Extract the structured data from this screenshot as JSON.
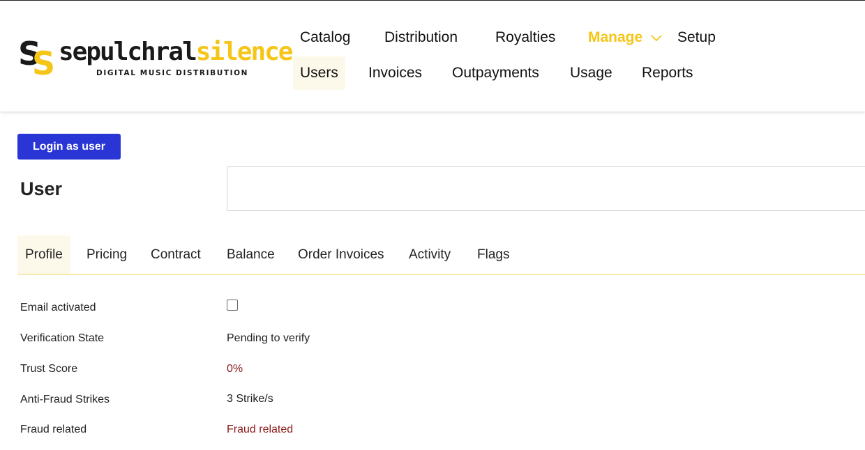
{
  "brand": {
    "name_part1": "sepulchral",
    "name_part2": "silence",
    "tagline": "DIGITAL MUSIC DISTRIBUTION",
    "colors": {
      "dark": "#1a1a1a",
      "accent": "#f5c518"
    }
  },
  "nav": {
    "top": [
      {
        "label": "Catalog"
      },
      {
        "label": "Distribution"
      },
      {
        "label": "Royalties"
      },
      {
        "label": "Manage",
        "active": true,
        "icon": "chevron-down-icon"
      },
      {
        "label": "Setup"
      }
    ],
    "sub": [
      {
        "label": "Users",
        "current": true
      },
      {
        "label": "Invoices"
      },
      {
        "label": "Outpayments"
      },
      {
        "label": "Usage"
      },
      {
        "label": "Reports"
      }
    ]
  },
  "actions": {
    "login_as_user": "Login as user",
    "button_color": "#2a35d6"
  },
  "page": {
    "title": "User",
    "user_field_value": ""
  },
  "tabs": [
    {
      "label": "Profile",
      "active": true
    },
    {
      "label": "Pricing"
    },
    {
      "label": "Contract"
    },
    {
      "label": "Balance"
    },
    {
      "label": "Order Invoices"
    },
    {
      "label": "Activity"
    },
    {
      "label": "Flags"
    }
  ],
  "profile": {
    "rows": [
      {
        "label": "Email activated",
        "type": "checkbox",
        "checked": false
      },
      {
        "label": "Verification State",
        "value": "Pending to verify"
      },
      {
        "label": "Trust Score",
        "value": "0%",
        "status": "danger"
      },
      {
        "label": "Anti-Fraud Strikes",
        "value": "3 Strike/s"
      },
      {
        "label": "Fraud related",
        "value": "Fraud related",
        "status": "danger"
      }
    ],
    "danger_color": "#8b1a1a"
  }
}
